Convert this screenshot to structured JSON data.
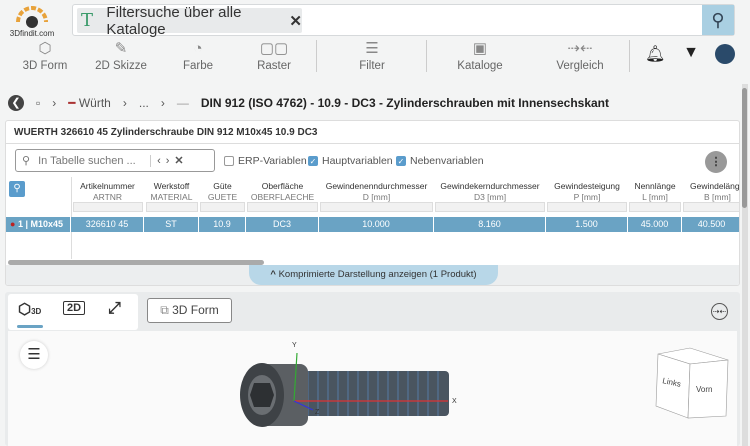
{
  "logo": {
    "text": "3Dfindit.com"
  },
  "search": {
    "chip_label": "Filtersuche über alle Kataloge",
    "chip_icon": "text-icon",
    "search_icon": "search-icon"
  },
  "toolbar": {
    "items": [
      {
        "label": "3D Form",
        "icon": "cube-icon"
      },
      {
        "label": "2D Skizze",
        "icon": "pencil-icon"
      },
      {
        "label": "Farbe",
        "icon": "palette-icon"
      },
      {
        "label": "Raster",
        "icon": "grid-icon"
      },
      {
        "label": "Filter",
        "icon": "sliders-icon"
      },
      {
        "label": "Kataloge",
        "icon": "catalog-icon"
      },
      {
        "label": "Vergleich",
        "icon": "compare-icon"
      }
    ]
  },
  "breadcrumb": {
    "items": [
      "Würth",
      "...",
      "DIN 912 (ISO 4762) - 10.9 - DC3 - Zylinderschrauben mit Innensechskant"
    ]
  },
  "table": {
    "title": "WUERTH 326610 45 Zylinderschraube DIN 912 M10x45 10.9 DC3",
    "search_placeholder": "In Tabelle suchen ...",
    "checkboxes": [
      {
        "label": "ERP-Variablen",
        "checked": false
      },
      {
        "label": "Hauptvariablen",
        "checked": true
      },
      {
        "label": "Nebenvariablen",
        "checked": true
      }
    ],
    "columns": [
      {
        "name": "Artikelnummer",
        "sub": "ARTNR"
      },
      {
        "name": "Werkstoff",
        "sub": "MATERIAL"
      },
      {
        "name": "Güte",
        "sub": "GUETE"
      },
      {
        "name": "Oberfläche",
        "sub": "OBERFLAECHE"
      },
      {
        "name": "Gewindenenndurchmesser",
        "sub": "D [mm]"
      },
      {
        "name": "Gewindekerndurchmesser",
        "sub": "D3 [mm]"
      },
      {
        "name": "Gewindesteigung",
        "sub": "P [mm]"
      },
      {
        "name": "Nennlänge",
        "sub": "L [mm]"
      },
      {
        "name": "Gewindelänge",
        "sub": "B [mm]"
      }
    ],
    "rows": [
      {
        "label": "1 | M10x45",
        "cells": [
          "326610 45",
          "ST",
          "10.9",
          "DC3",
          "10.000",
          "8.160",
          "1.500",
          "45.000",
          "40.500"
        ]
      }
    ],
    "compress_label": "Komprimierte Darstellung anzeigen (1 Produkt)"
  },
  "viewer": {
    "tabs": [
      "3D",
      "2D"
    ],
    "form_button": "3D Form",
    "axes": [
      "Y",
      "X",
      "Z"
    ],
    "cube_faces": [
      "Links",
      "Vorn"
    ]
  }
}
